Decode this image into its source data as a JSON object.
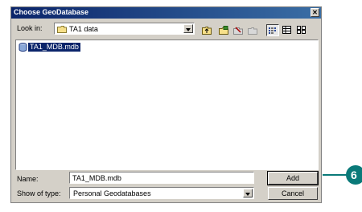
{
  "window": {
    "title": "Choose GeoDatabase",
    "close_glyph": "✕"
  },
  "look_in": {
    "label": "Look in:",
    "value": "TA1 data",
    "icon": "folder-icon"
  },
  "toolbar": {
    "buttons": [
      {
        "name": "up-one-level-icon"
      },
      {
        "name": "connect-folder-icon"
      },
      {
        "name": "disconnect-folder-icon"
      },
      {
        "name": "new-folder-icon"
      },
      {
        "name": "list-view-icon"
      },
      {
        "name": "details-view-icon"
      },
      {
        "name": "thumbnails-view-icon"
      }
    ]
  },
  "file_list": {
    "items": [
      {
        "label": "TA1_MDB.mdb",
        "icon": "personal-geodatabase-icon",
        "selected": true
      }
    ]
  },
  "name_field": {
    "label": "Name:",
    "value": "TA1_MDB.mdb"
  },
  "type_field": {
    "label": "Show of type:",
    "value": "Personal Geodatabases"
  },
  "buttons": {
    "add": "Add",
    "cancel": "Cancel"
  },
  "callout": {
    "number": "6",
    "color": "#0a7a79"
  },
  "colors": {
    "title_bar": "#0a246a",
    "selection": "#0a246a",
    "dialog_bg": "#d4d0c8"
  }
}
